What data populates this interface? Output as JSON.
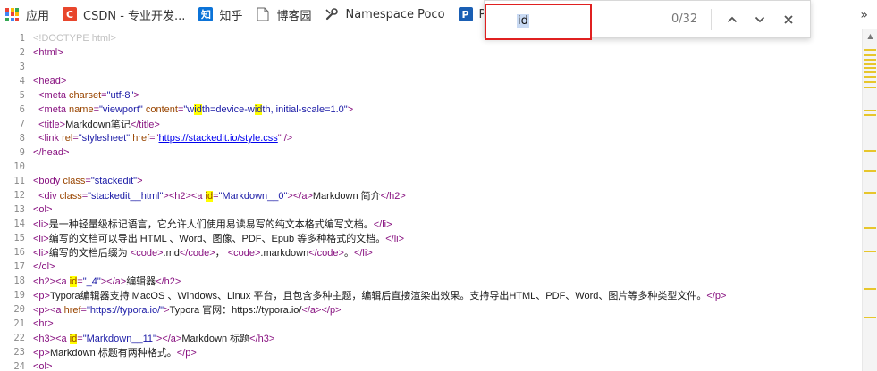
{
  "bookmarks": [
    {
      "label": "应用",
      "icon": "apps-grid-icon"
    },
    {
      "label": "CSDN - 专业开发...",
      "icon": "csdn-logo-icon",
      "glyph": "C",
      "color": "#e8462c"
    },
    {
      "label": "知乎",
      "icon": "zhihu-logo-icon",
      "glyph": "知",
      "color": "#0b73d8"
    },
    {
      "label": "博客园",
      "icon": "page-icon"
    },
    {
      "label": "Namespace Poco",
      "icon": "tools-icon"
    },
    {
      "label": "POC",
      "icon": "poco-logo-icon",
      "glyph": "P",
      "color": "#1a5fb4"
    }
  ],
  "bookmarks_overflow": "»",
  "find": {
    "query": "id",
    "count": "0/32",
    "prev_icon": "chevron-up-icon",
    "next_icon": "chevron-down-icon",
    "close_icon": "close-icon"
  },
  "colors": {
    "tag": "#881280",
    "attr": "#994500",
    "value": "#1a1aa6",
    "link": "#0000ee",
    "doctype": "#c0c0c0",
    "highlight": "#ffff00",
    "text": "#1a1a1a",
    "find_border": "#e02020",
    "scroll_marker": "#e7c62b"
  },
  "source_lines": [
    {
      "n": "1",
      "parts": [
        {
          "t": "<!DOCTYPE html>",
          "c": "doctype"
        }
      ]
    },
    {
      "n": "2",
      "parts": [
        {
          "t": "<html>",
          "c": "tag"
        }
      ]
    },
    {
      "n": "3",
      "parts": []
    },
    {
      "n": "4",
      "parts": [
        {
          "t": "<head>",
          "c": "tag"
        }
      ]
    },
    {
      "n": "5",
      "parts": [
        {
          "t": "  <meta ",
          "c": "tag"
        },
        {
          "t": "charset",
          "c": "attr"
        },
        {
          "t": "=",
          "c": "tag"
        },
        {
          "t": "\"utf-8\"",
          "c": "value"
        },
        {
          "t": ">",
          "c": "tag"
        }
      ]
    },
    {
      "n": "6",
      "parts": [
        {
          "t": "  <meta ",
          "c": "tag"
        },
        {
          "t": "name",
          "c": "attr"
        },
        {
          "t": "=",
          "c": "tag"
        },
        {
          "t": "\"viewport\"",
          "c": "value"
        },
        {
          "t": " ",
          "c": "tag"
        },
        {
          "t": "content",
          "c": "attr"
        },
        {
          "t": "=",
          "c": "tag"
        },
        {
          "t": "\"w",
          "c": "value"
        },
        {
          "t": "id",
          "c": "value",
          "hl": true
        },
        {
          "t": "th=device-w",
          "c": "value"
        },
        {
          "t": "id",
          "c": "value",
          "hl": true
        },
        {
          "t": "th, initial-scale=1.0\"",
          "c": "value"
        },
        {
          "t": ">",
          "c": "tag"
        }
      ]
    },
    {
      "n": "7",
      "parts": [
        {
          "t": "  <title>",
          "c": "tag"
        },
        {
          "t": "Markdown笔记",
          "c": "text"
        },
        {
          "t": "</title>",
          "c": "tag"
        }
      ]
    },
    {
      "n": "8",
      "parts": [
        {
          "t": "  <link ",
          "c": "tag"
        },
        {
          "t": "rel",
          "c": "attr"
        },
        {
          "t": "=",
          "c": "tag"
        },
        {
          "t": "\"stylesheet\"",
          "c": "value"
        },
        {
          "t": " ",
          "c": "tag"
        },
        {
          "t": "href",
          "c": "attr"
        },
        {
          "t": "=\"",
          "c": "tag"
        },
        {
          "t": "https://stackedit.io/style.css",
          "c": "link",
          "u": true
        },
        {
          "t": "\" />",
          "c": "tag"
        }
      ]
    },
    {
      "n": "9",
      "parts": [
        {
          "t": "</head>",
          "c": "tag"
        }
      ]
    },
    {
      "n": "10",
      "parts": []
    },
    {
      "n": "11",
      "parts": [
        {
          "t": "<body ",
          "c": "tag"
        },
        {
          "t": "class",
          "c": "attr"
        },
        {
          "t": "=",
          "c": "tag"
        },
        {
          "t": "\"stackedit\"",
          "c": "value"
        },
        {
          "t": ">",
          "c": "tag"
        }
      ]
    },
    {
      "n": "12",
      "parts": [
        {
          "t": "  <div ",
          "c": "tag"
        },
        {
          "t": "class",
          "c": "attr"
        },
        {
          "t": "=",
          "c": "tag"
        },
        {
          "t": "\"stackedit__html\"",
          "c": "value"
        },
        {
          "t": "><h2><a ",
          "c": "tag"
        },
        {
          "t": "id",
          "c": "attr",
          "hl": true
        },
        {
          "t": "=",
          "c": "tag"
        },
        {
          "t": "\"Markdown__0\"",
          "c": "value"
        },
        {
          "t": "></a>",
          "c": "tag"
        },
        {
          "t": "Markdown 简介",
          "c": "text"
        },
        {
          "t": "</h2>",
          "c": "tag"
        }
      ]
    },
    {
      "n": "13",
      "parts": [
        {
          "t": "<ol>",
          "c": "tag"
        }
      ]
    },
    {
      "n": "14",
      "parts": [
        {
          "t": "<li>",
          "c": "tag"
        },
        {
          "t": "是一种轻量级标记语言，它允许人们使用易读易写的纯文本格式编写文档。",
          "c": "text"
        },
        {
          "t": "</li>",
          "c": "tag"
        }
      ]
    },
    {
      "n": "15",
      "parts": [
        {
          "t": "<li>",
          "c": "tag"
        },
        {
          "t": "编写的文档可以导出 HTML 、Word、图像、PDF、Epub 等多种格式的文档。",
          "c": "text"
        },
        {
          "t": "</li>",
          "c": "tag"
        }
      ]
    },
    {
      "n": "16",
      "parts": [
        {
          "t": "<li>",
          "c": "tag"
        },
        {
          "t": "编写的文档后缀为 ",
          "c": "text"
        },
        {
          "t": "<code>",
          "c": "tag"
        },
        {
          "t": ".md",
          "c": "text"
        },
        {
          "t": "</code>",
          "c": "tag"
        },
        {
          "t": "， ",
          "c": "text"
        },
        {
          "t": "<code>",
          "c": "tag"
        },
        {
          "t": ".markdown",
          "c": "text"
        },
        {
          "t": "</code>",
          "c": "tag"
        },
        {
          "t": "。",
          "c": "text"
        },
        {
          "t": "</li>",
          "c": "tag"
        }
      ]
    },
    {
      "n": "17",
      "parts": [
        {
          "t": "</ol>",
          "c": "tag"
        }
      ]
    },
    {
      "n": "18",
      "parts": [
        {
          "t": "<h2><a ",
          "c": "tag"
        },
        {
          "t": "id",
          "c": "attr",
          "hl": true
        },
        {
          "t": "=",
          "c": "tag"
        },
        {
          "t": "\"_4\"",
          "c": "value"
        },
        {
          "t": "></a>",
          "c": "tag"
        },
        {
          "t": "编辑器",
          "c": "text"
        },
        {
          "t": "</h2>",
          "c": "tag"
        }
      ]
    },
    {
      "n": "19",
      "parts": [
        {
          "t": "<p>",
          "c": "tag"
        },
        {
          "t": "Typora编辑器支持 MacOS 、Windows、Linux 平台，且包含多种主题，编辑后直接渲染出效果。支持导出HTML、PDF、Word、图片等多种类型文件。",
          "c": "text"
        },
        {
          "t": "</p>",
          "c": "tag"
        }
      ]
    },
    {
      "n": "20",
      "parts": [
        {
          "t": "<p><a ",
          "c": "tag"
        },
        {
          "t": "href",
          "c": "attr"
        },
        {
          "t": "=",
          "c": "tag"
        },
        {
          "t": "\"https://typora.io/\"",
          "c": "value"
        },
        {
          "t": ">",
          "c": "tag"
        },
        {
          "t": "Typora 官网：https://typora.io/",
          "c": "text"
        },
        {
          "t": "</a></p>",
          "c": "tag"
        }
      ]
    },
    {
      "n": "21",
      "parts": [
        {
          "t": "<hr>",
          "c": "tag"
        }
      ]
    },
    {
      "n": "22",
      "parts": [
        {
          "t": "<h3><a ",
          "c": "tag"
        },
        {
          "t": "id",
          "c": "attr",
          "hl": true
        },
        {
          "t": "=",
          "c": "tag"
        },
        {
          "t": "\"Markdown__11\"",
          "c": "value"
        },
        {
          "t": "></a>",
          "c": "tag"
        },
        {
          "t": "Markdown 标题",
          "c": "text"
        },
        {
          "t": "</h3>",
          "c": "tag"
        }
      ]
    },
    {
      "n": "23",
      "parts": [
        {
          "t": "<p>",
          "c": "tag"
        },
        {
          "t": "Markdown 标题有两种格式。",
          "c": "text"
        },
        {
          "t": "</p>",
          "c": "tag"
        }
      ]
    },
    {
      "n": "24",
      "parts": [
        {
          "t": "<ol>",
          "c": "tag"
        }
      ]
    }
  ]
}
